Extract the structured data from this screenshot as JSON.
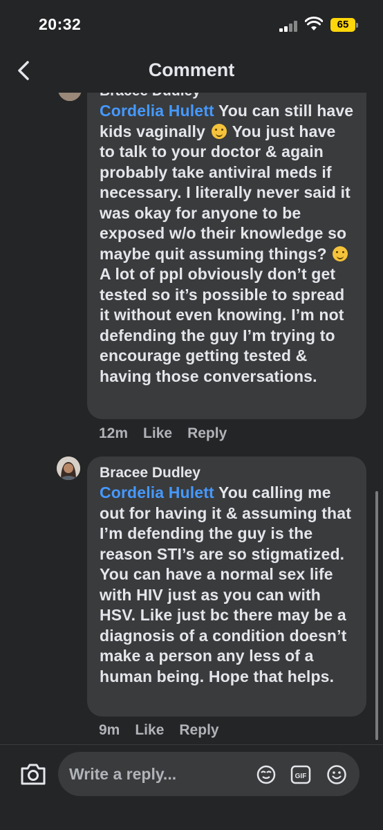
{
  "status": {
    "time": "20:32",
    "battery": "65"
  },
  "header": {
    "title": "Comment"
  },
  "comments": [
    {
      "author": "Bracee Dudley",
      "mention": "Cordelia Hulett",
      "text_part1": " You can still have kids vaginally ",
      "emoji": "rolling-on-floor-laughing",
      "text_part2": " You just have to talk to your doctor & again probably take antiviral meds if necessary. I literally never said it was okay for anyone to be exposed w/o their knowledge so maybe quit assuming things? ",
      "emoji2": "slightly-smiling-face",
      "text_part3": " A lot of ppl obviously don’t get tested so it’s possible to spread it without even knowing. I’m not defending the guy I’m trying to encourage getting tested & having those conversations.",
      "time": "12m",
      "like": "Like",
      "reply": "Reply"
    },
    {
      "author": "Bracee Dudley",
      "mention": "Cordelia Hulett",
      "text": "  You calling me out for having it & assuming that I’m defending the guy is the reason STI’s are so stigmatized. You can have a normal sex life with HIV just as you can with HSV. Like just bc there may be a diagnosis of a condition doesn’t make a person any less of a human being. Hope that helps.",
      "time": "9m",
      "like": "Like",
      "reply": "Reply"
    }
  ],
  "composer": {
    "placeholder": "Write a reply..."
  },
  "icons": {
    "back": "chevron-left-icon",
    "camera": "camera-icon",
    "avatar_sticker": "avatar-sticker-icon",
    "gif": "gif-icon",
    "emoji": "emoji-icon"
  }
}
